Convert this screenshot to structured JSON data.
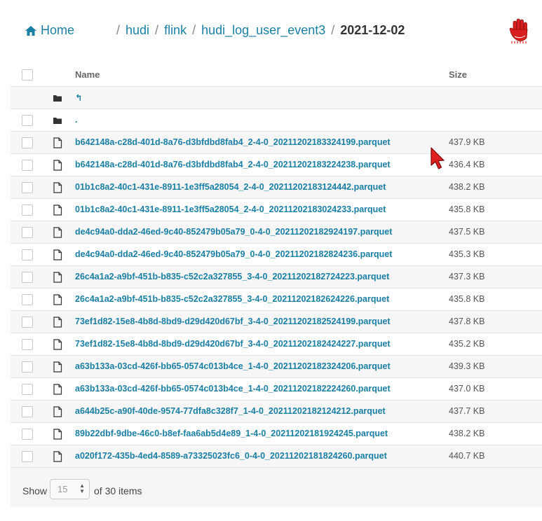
{
  "nav": {
    "home_label": "Home",
    "breadcrumbs": [
      {
        "label": "hudi"
      },
      {
        "label": "flink"
      },
      {
        "label": "hudi_log_user_event3"
      }
    ],
    "current": "2021-12-02",
    "separator": "/"
  },
  "table": {
    "headers": {
      "name": "Name",
      "size": "Size"
    },
    "dir_rows": [
      {
        "name": "↰",
        "icon": "folder-icon"
      },
      {
        "name": ".",
        "icon": "folder-icon"
      }
    ],
    "files": [
      {
        "name": "b642148a-c28d-401d-8a76-d3bfdbd8fab4_2-4-0_20211202183324199.parquet",
        "size": "437.9 KB"
      },
      {
        "name": "b642148a-c28d-401d-8a76-d3bfdbd8fab4_2-4-0_20211202183224238.parquet",
        "size": "436.4 KB"
      },
      {
        "name": "01b1c8a2-40c1-431e-8911-1e3ff5a28054_2-4-0_20211202183124442.parquet",
        "size": "438.2 KB"
      },
      {
        "name": "01b1c8a2-40c1-431e-8911-1e3ff5a28054_2-4-0_20211202183024233.parquet",
        "size": "435.8 KB"
      },
      {
        "name": "de4c94a0-dda2-46ed-9c40-852479b05a79_0-4-0_20211202182924197.parquet",
        "size": "437.5 KB"
      },
      {
        "name": "de4c94a0-dda2-46ed-9c40-852479b05a79_0-4-0_20211202182824236.parquet",
        "size": "435.3 KB"
      },
      {
        "name": "26c4a1a2-a9bf-451b-b835-c52c2a327855_3-4-0_20211202182724223.parquet",
        "size": "437.3 KB"
      },
      {
        "name": "26c4a1a2-a9bf-451b-b835-c52c2a327855_3-4-0_20211202182624226.parquet",
        "size": "435.8 KB"
      },
      {
        "name": "73ef1d82-15e8-4b8d-8bd9-d29d420d67bf_3-4-0_20211202182524199.parquet",
        "size": "437.8 KB"
      },
      {
        "name": "73ef1d82-15e8-4b8d-8bd9-d29d420d67bf_3-4-0_20211202182424227.parquet",
        "size": "435.2 KB"
      },
      {
        "name": "a63b133a-03cd-426f-bb65-0574c013b4ce_1-4-0_20211202182324206.parquet",
        "size": "439.3 KB"
      },
      {
        "name": "a63b133a-03cd-426f-bb65-0574c013b4ce_1-4-0_20211202182224260.parquet",
        "size": "437.0 KB"
      },
      {
        "name": "a644b25c-a90f-40de-9574-77dfa8c328f7_1-4-0_20211202182124212.parquet",
        "size": "437.7 KB"
      },
      {
        "name": "89b22dbf-9dbe-46c0-b8ef-faa6ab5d4e89_1-4-0_20211202181924245.parquet",
        "size": "438.2 KB"
      },
      {
        "name": "a020f172-435b-4ed4-8589-a73325023fc6_0-4-0_20211202181824260.parquet",
        "size": "440.7 KB"
      }
    ]
  },
  "pagination": {
    "show_label": "Show",
    "page_size": "15",
    "of_label": "of 30 items"
  },
  "colors": {
    "link": "#1a7fa6",
    "row_alt": "#f6f6f6",
    "logo_red": "#d81e1e"
  }
}
